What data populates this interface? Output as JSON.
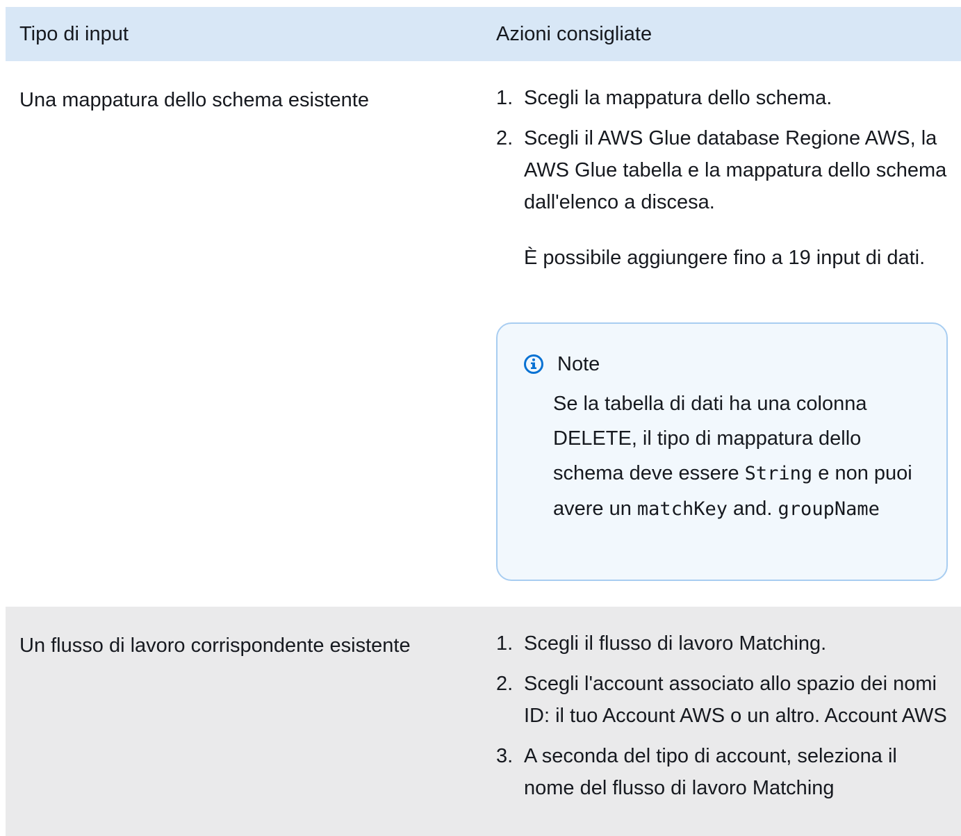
{
  "table": {
    "headers": [
      "Tipo di input",
      "Azioni consigliate"
    ],
    "rows": [
      {
        "type": "Una mappatura dello schema esistente",
        "actions": [
          {
            "num": "1.",
            "text": "Scegli la mappatura dello schema."
          },
          {
            "num": "2.",
            "text": "Scegli il AWS Glue database Regione AWS, la AWS Glue tabella e la mappatura dello schema dall'elenco a discesa."
          }
        ],
        "paragraph": "È possibile aggiungere fino a 19 input di dati.",
        "note": {
          "title": "Note",
          "text_a": "Se la tabella di dati ha una colonna DELETE, il tipo di mappatura dello schema deve essere",
          "code_a": "String",
          "text_b": "e non puoi avere un",
          "code_b": "matchKey",
          "text_c": "and.",
          "code_c": "groupName"
        }
      },
      {
        "type": "Un flusso di lavoro corrispondente esistente",
        "actions": [
          {
            "num": "1.",
            "text": "Scegli il flusso di lavoro Matching."
          },
          {
            "num": "2.",
            "text": "Scegli l'account associato allo spazio dei nomi ID: il tuo Account AWS o un altro. Account AWS"
          },
          {
            "num": "3.",
            "text": "A seconda del tipo di account, seleziona il nome del flusso di lavoro Matching"
          }
        ]
      }
    ]
  },
  "colors": {
    "header_bg": "#d8e7f6",
    "alt_row_bg": "#eaeaeb",
    "note_border": "#a8cdf1",
    "note_bg": "#f2f8fd",
    "info_icon": "#0972d3"
  }
}
